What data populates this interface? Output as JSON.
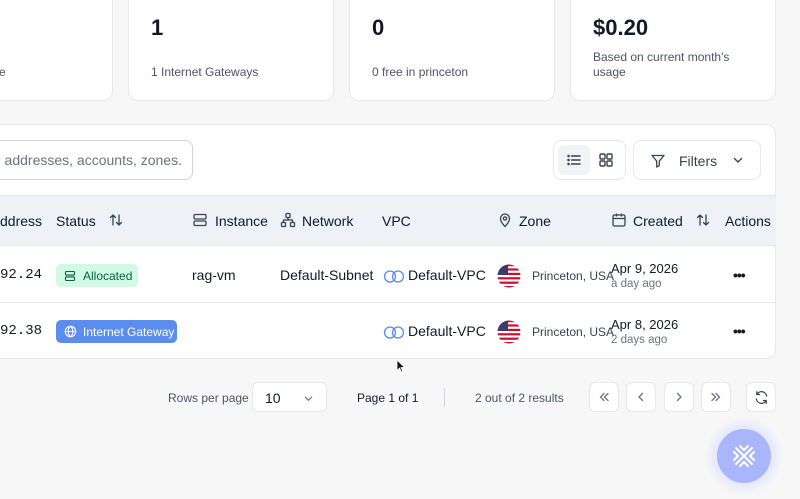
{
  "stats": [
    {
      "value": "",
      "sub": "e"
    },
    {
      "value": "1",
      "sub": "1 Internet Gateways"
    },
    {
      "value": "0",
      "sub": "0 free in princeton"
    },
    {
      "value": "$0.20",
      "sub": "Based on current month's usage"
    }
  ],
  "search": {
    "value": "IP addresses, accounts, zones."
  },
  "filters": {
    "label": "Filters"
  },
  "table": {
    "headers": {
      "address": "ddress",
      "status": "Status",
      "instance": "Instance",
      "network": "Network",
      "vpc": "VPC",
      "zone": "Zone",
      "created": "Created",
      "actions": "Actions"
    },
    "rows": [
      {
        "ip": "92.24",
        "status": "Allocated",
        "instance": "rag-vm",
        "network": "Default-Subnet",
        "vpc": "Default-VPC",
        "zone": "Princeton, USA",
        "date": "Apr 9, 2026",
        "ago": "a day ago"
      },
      {
        "ip": "92.38",
        "status": "Internet Gateway",
        "instance": "",
        "network": "",
        "vpc": "Default-VPC",
        "zone": "Princeton, USA",
        "date": "Apr 8, 2026",
        "ago": "2 days ago"
      }
    ]
  },
  "pagination": {
    "rows_per_page_label": "Rows per page",
    "rows_per_page": "10",
    "page": "Page 1 of 1",
    "results": "2 out of 2 results"
  },
  "colors": {
    "allocated_bg": "#d1fae5",
    "gateway_bg": "#5b8def",
    "fab": "#aab6fb"
  }
}
